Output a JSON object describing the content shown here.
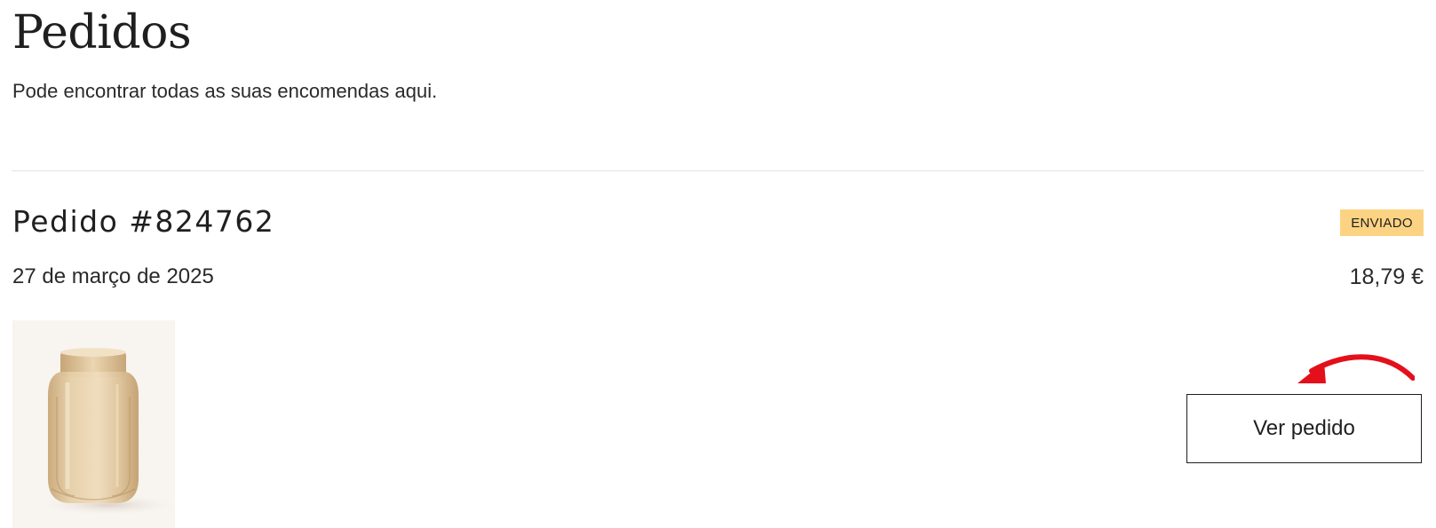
{
  "header": {
    "title": "Pedidos",
    "subtitle": "Pode encontrar todas as suas encomendas aqui."
  },
  "order": {
    "title": "Pedido #824762",
    "status": "ENVIADO",
    "date": "27 de março de 2025",
    "total": "18,79 €",
    "view_button_label": "Ver pedido",
    "product_image_icon": "glass-vase-image"
  },
  "colors": {
    "status_badge_bg": "#fcd383",
    "annotation_arrow": "#e3101c",
    "text": "#1f1f1f"
  }
}
